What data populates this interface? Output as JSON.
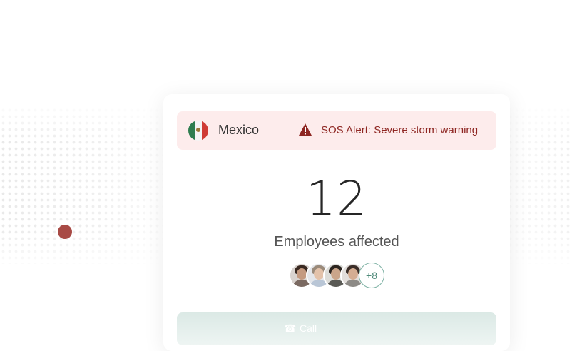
{
  "alert": {
    "country": "Mexico",
    "message": "SOS Alert: Severe storm warning",
    "flag_icon": "mexico-flag-icon",
    "warning_icon": "warning-triangle-icon",
    "background_color": "#fdecec",
    "text_color": "#8e2622"
  },
  "stats": {
    "count": "12",
    "label": "Employees affected"
  },
  "avatars": {
    "extra_count": "+8"
  },
  "call": {
    "label": "Call",
    "icon": "phone-icon"
  },
  "map": {
    "pin_color": "#a84a45"
  }
}
